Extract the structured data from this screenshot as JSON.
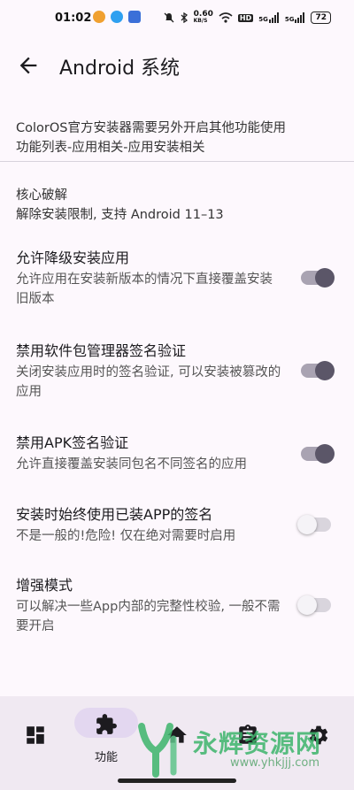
{
  "status_bar": {
    "time": "01:02",
    "net_speed": "0.60",
    "net_unit": "KB/S",
    "hd": "HD",
    "signal1": "5G",
    "signal2": "5G",
    "battery": "72"
  },
  "toolbar": {
    "title": "Android 系统"
  },
  "notice": {
    "line1": "ColorOS官方安装器需要另外开启其他功能使用",
    "line2": "功能列表-应用相关-应用安装相关"
  },
  "section": {
    "title": "核心破解",
    "subtitle": "解除安装限制, 支持 Android 11–13"
  },
  "prefs": [
    {
      "title": "允许降级安装应用",
      "summary": "允许应用在安装新版本的情况下直接覆盖安装旧版本",
      "checked": true
    },
    {
      "title": "禁用软件包管理器签名验证",
      "summary": "关闭安装应用时的签名验证, 可以安装被篡改的应用",
      "checked": true
    },
    {
      "title": "禁用APK签名验证",
      "summary": "允许直接覆盖安装同包名不同签名的应用",
      "checked": true
    },
    {
      "title": "安装时始终使用已装APP的签名",
      "summary": "不是一般的!危险! 仅在绝对需要时启用",
      "checked": false
    },
    {
      "title": "增强模式",
      "summary": "可以解决一些App内部的完整性校验, 一般不需要开启",
      "checked": false
    }
  ],
  "bottom_nav": {
    "items": [
      {
        "icon": "dashboard-icon",
        "label": ""
      },
      {
        "icon": "extension-icon",
        "label": "功能"
      },
      {
        "icon": "home-icon",
        "label": ""
      },
      {
        "icon": "clipboard-icon",
        "label": ""
      },
      {
        "icon": "gear-icon",
        "label": ""
      }
    ]
  },
  "watermark": {
    "text": "永辉资源网",
    "url": "www.yhkjjj.com"
  },
  "colors": {
    "background": "#fdf8fd",
    "switch_on_thumb": "#5b5668",
    "switch_on_track": "#a9a3b2",
    "nav_background": "#f0e9f2",
    "nav_indicator": "#e3d7f0",
    "watermark_green": "#3db56c"
  }
}
